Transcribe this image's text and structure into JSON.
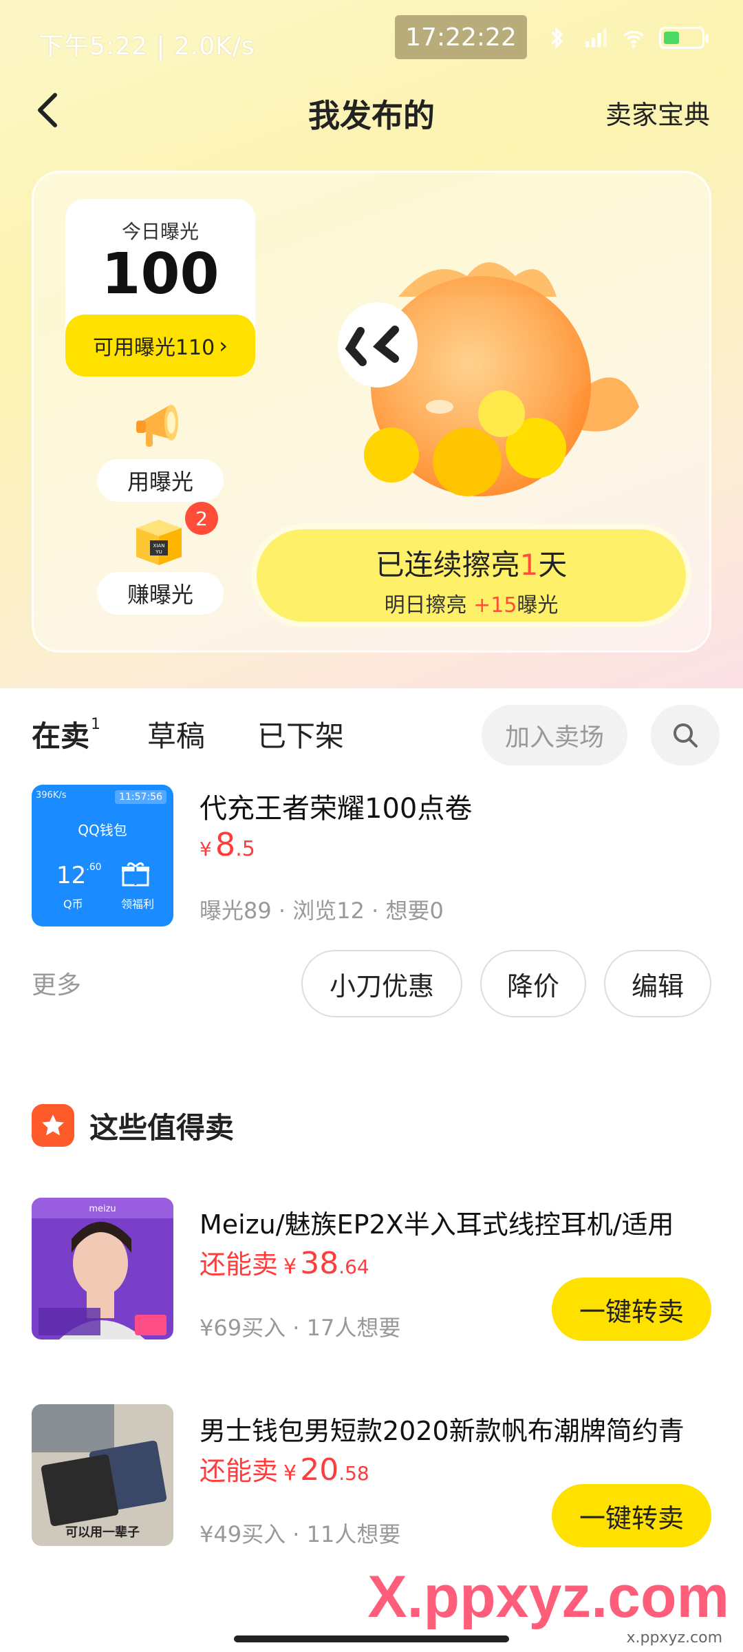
{
  "status_bar": {
    "left_text": "下午5:22 | 2.0K/s",
    "time": "17:22:22"
  },
  "header": {
    "title": "我发布的",
    "right_link": "卖家宝典"
  },
  "exposure": {
    "today_label": "今日曝光",
    "today_value": "100",
    "available_label": "可用曝光110",
    "use_label": "用曝光",
    "earn_label": "赚曝光",
    "earn_badge": "2",
    "streak_prefix": "已连续擦亮",
    "streak_days": "1",
    "streak_suffix": "天",
    "tomorrow_prefix": "明日擦亮",
    "tomorrow_bonus": "+15",
    "tomorrow_suffix": "曝光"
  },
  "tabs": {
    "on_sale": "在卖",
    "on_sale_count": "1",
    "drafts": "草稿",
    "off_shelf": "已下架",
    "join_market": "加入卖场"
  },
  "listing": {
    "title": "代充王者荣耀100点卷",
    "price_symbol": "¥",
    "price_int": "8",
    "price_dec": ".5",
    "stats": "曝光89 · 浏览12 · 想要0",
    "more": "更多",
    "btn_discount": "小刀优惠",
    "btn_reduce": "降价",
    "btn_edit": "编辑",
    "thumb": {
      "top_text": "396K/s",
      "clock": "11:57:56",
      "wallet": "QQ钱包",
      "num": "12",
      "num_sup": ".60",
      "unit": "Q币",
      "gift_label": "领福利"
    }
  },
  "recommend": {
    "section_title": "这些值得卖",
    "items": [
      {
        "title": "Meizu/魅族EP2X半入耳式线控耳机/适用",
        "sell_label": "还能卖",
        "price_symbol": "¥",
        "price_int": "38",
        "price_dec": ".64",
        "meta": "¥69买入 · 17人想要",
        "btn": "一键转卖"
      },
      {
        "title": "男士钱包男短款2020新款帆布潮牌简约青",
        "sell_label": "还能卖",
        "price_symbol": "¥",
        "price_int": "20",
        "price_dec": ".58",
        "meta": "¥49买入 · 11人想要",
        "btn": "一键转卖",
        "thumb_caption": "可以用一辈子"
      }
    ]
  },
  "watermark": {
    "text": "X.ppxyz.com",
    "sub": "x.ppxyz.com"
  },
  "colors": {
    "accent_yellow": "#ffe100",
    "price_red": "#ff3b3b",
    "badge_red": "#ff4d3a"
  }
}
